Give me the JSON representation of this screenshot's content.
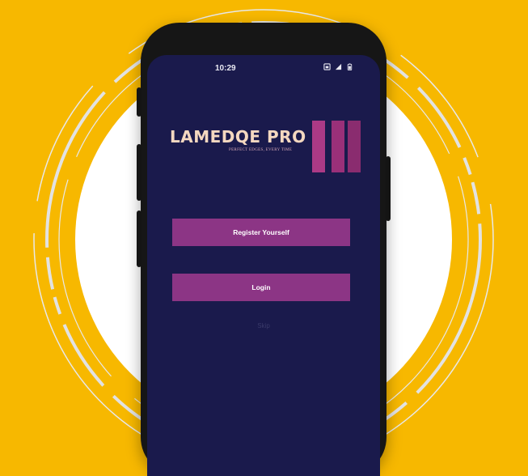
{
  "colors": {
    "background": "#F7B800",
    "circle": "#FFFFFF",
    "ring": "#E2E2E2",
    "screen": "#1A1A4C",
    "logo_text": "#F4D8C0",
    "logo_bars": [
      "#AC3A86",
      "#9A3079",
      "#8A2C6F"
    ],
    "button": "#8C3585"
  },
  "status_bar": {
    "time": "10:29",
    "icons": [
      "sim-icon",
      "signal-icon",
      "battery-icon"
    ]
  },
  "logo": {
    "name": "LAMEDQE PRO",
    "tagline": "PERFECT EDGES, EVERY TIME"
  },
  "actions": {
    "register_label": "Register Yourself",
    "login_label": "Login",
    "skip_label": "Skip"
  }
}
